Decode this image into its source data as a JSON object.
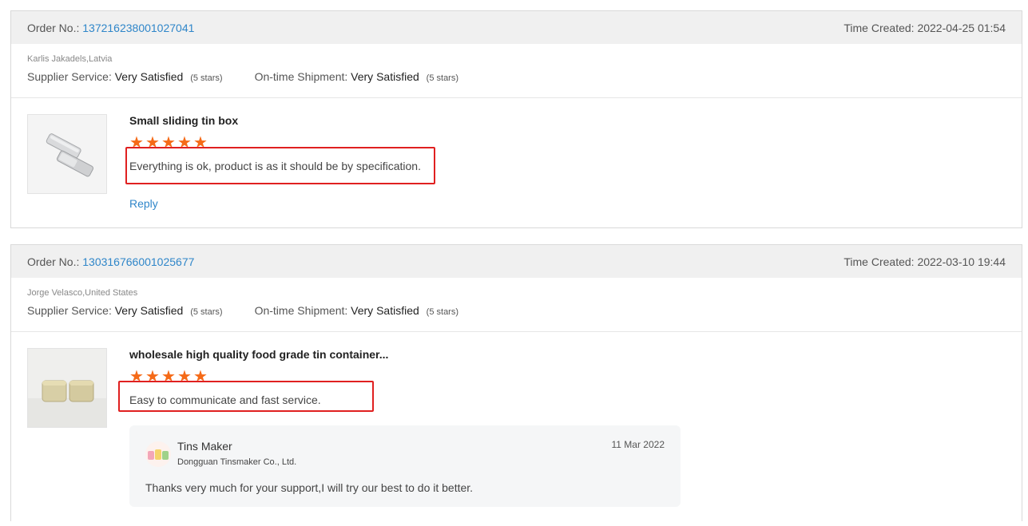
{
  "reviews": [
    {
      "order_label": "Order No.:",
      "order_number": "137216238001027041",
      "time_label": "Time Created:",
      "time_value": "2022-04-25 01:54",
      "buyer": "Karlis Jakadels,Latvia",
      "supplier_label": "Supplier Service:",
      "supplier_value": "Very Satisfied",
      "supplier_stars": "(5 stars)",
      "shipment_label": "On-time Shipment:",
      "shipment_value": "Very Satisfied",
      "shipment_stars": "(5 stars)",
      "product_title": "Small sliding tin box",
      "rating": 5,
      "text": "Everything is ok, product is as it should be by specification.",
      "reply_label": "Reply"
    },
    {
      "order_label": "Order No.:",
      "order_number": "130316766001025677",
      "time_label": "Time Created:",
      "time_value": "2022-03-10 19:44",
      "buyer": "Jorge Velasco,United States",
      "supplier_label": "Supplier Service:",
      "supplier_value": "Very Satisfied",
      "supplier_stars": "(5 stars)",
      "shipment_label": "On-time Shipment:",
      "shipment_value": "Very Satisfied",
      "shipment_stars": "(5 stars)",
      "product_title": "wholesale high quality food grade tin container...",
      "rating": 5,
      "text": "Easy to communicate and fast service.",
      "seller_reply": {
        "name": "Tins Maker",
        "company": "Dongguan Tinsmaker Co., Ltd.",
        "date": "11 Mar 2022",
        "text": "Thanks very much for your support,I will try our best to do it better."
      }
    }
  ],
  "colors": {
    "link": "#2f86c9",
    "star": "#f56a17",
    "highlight": "#e02020",
    "header_bg": "#f0f0f0"
  }
}
